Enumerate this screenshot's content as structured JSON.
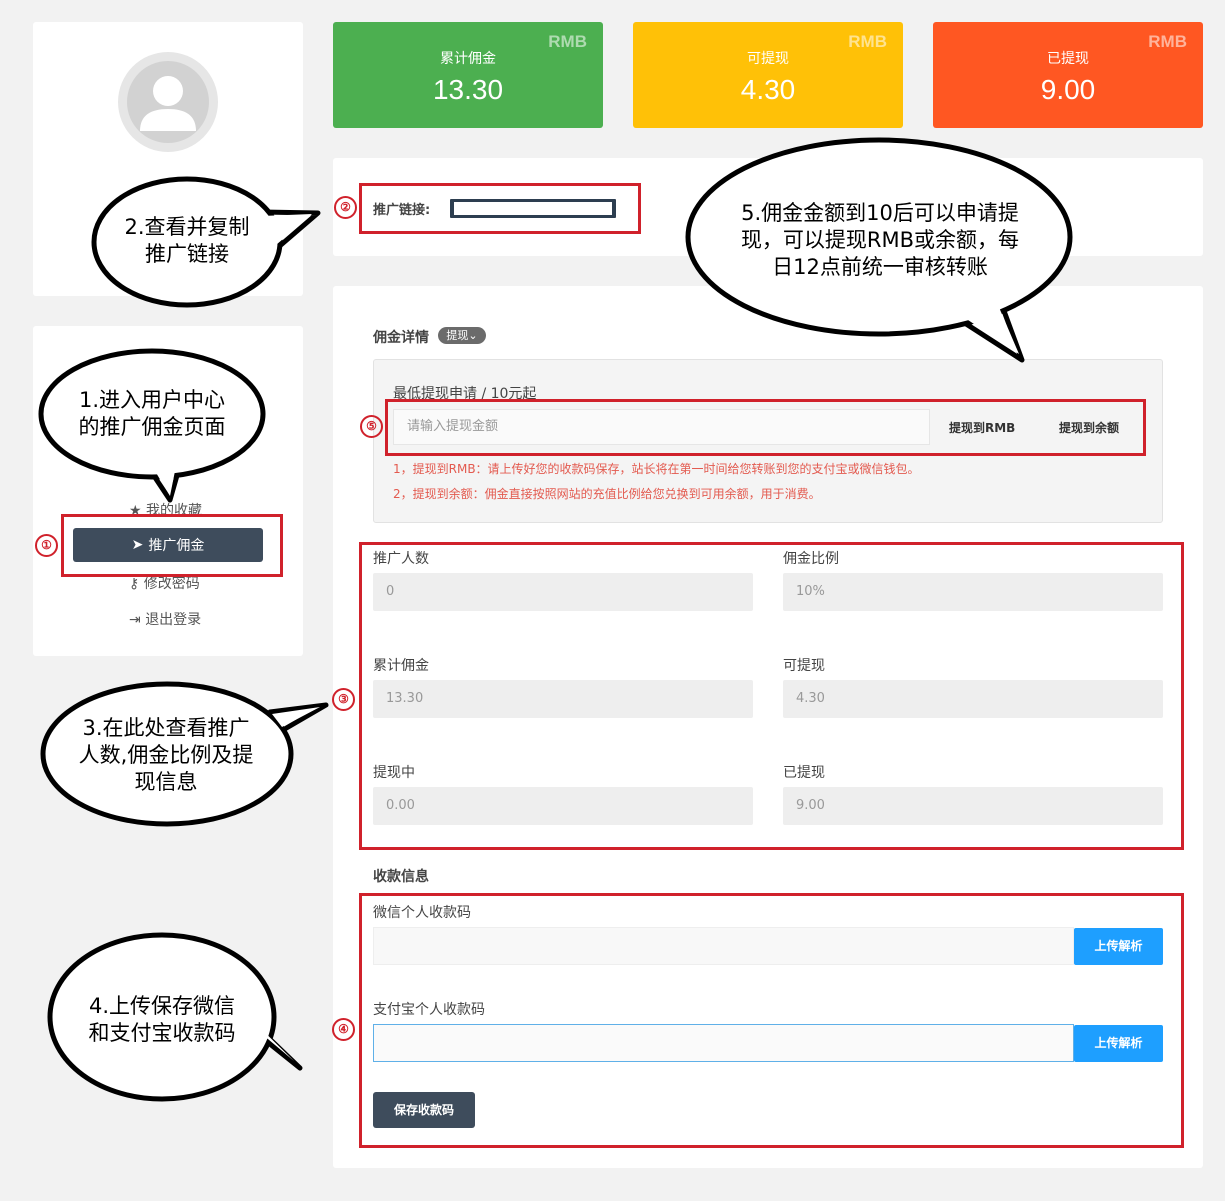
{
  "stats": [
    {
      "label": "累计佣金",
      "value": "13.30",
      "unit": "RMB",
      "color": "#4caf50"
    },
    {
      "label": "可提现",
      "value": "4.30",
      "unit": "RMB",
      "color": "#ffc107"
    },
    {
      "label": "已提现",
      "value": "9.00",
      "unit": "RMB",
      "color": "#ff5722"
    }
  ],
  "sidebar": {
    "items": [
      "我的收藏",
      "推广佣金",
      "修改密码",
      "退出登录"
    ]
  },
  "promo": {
    "label": "推广链接:"
  },
  "commission": {
    "title": "佣金详情",
    "badge": "提现",
    "min_text": "最低提现申请 / 10元起",
    "input_placeholder": "请输入提现金额",
    "btn_rmb": "提现到RMB",
    "btn_balance": "提现到余额",
    "note1": "1，提现到RMB：请上传好您的收款码保存，站长将在第一时间给您转账到您的支付宝或微信钱包。",
    "note2": "2，提现到余额：佣金直接按照网站的充值比例给您兑换到可用余额，用于消费。"
  },
  "fields": [
    {
      "label": "推广人数",
      "value": "0"
    },
    {
      "label": "佣金比例",
      "value": "10%"
    },
    {
      "label": "累计佣金",
      "value": "13.30"
    },
    {
      "label": "可提现",
      "value": "4.30"
    },
    {
      "label": "提现中",
      "value": "0.00"
    },
    {
      "label": "已提现",
      "value": "9.00"
    }
  ],
  "payment": {
    "title": "收款信息",
    "wechat_label": "微信个人收款码",
    "alipay_label": "支付宝个人收款码",
    "upload_label": "上传解析",
    "save_label": "保存收款码"
  },
  "markers": [
    "①",
    "②",
    "③",
    "④",
    "⑤"
  ],
  "bubbles": {
    "b1": [
      "1.进入用户中心",
      "的推广佣金页面"
    ],
    "b2": [
      "2.查看并复制",
      "推广链接"
    ],
    "b3": [
      "3.在此处查看推广",
      "人数,佣金比例及提",
      "现信息"
    ],
    "b4": [
      "4.上传保存微信",
      "和支付宝收款码"
    ],
    "b5": [
      "5.佣金金额到10后可以申请提",
      "现，可以提现RMB或余额，每",
      "日12点前统一审核转账"
    ]
  }
}
